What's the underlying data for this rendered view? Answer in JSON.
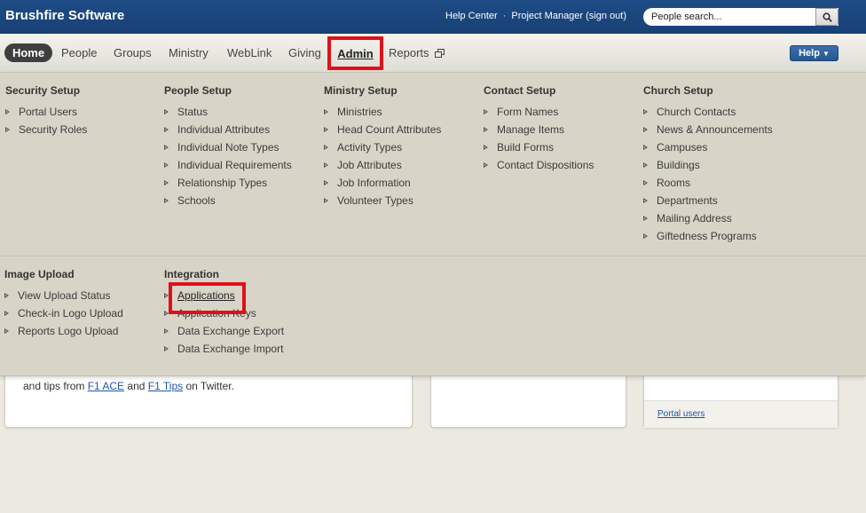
{
  "header": {
    "brand": "Brushfire Software",
    "help_center": "Help Center",
    "separator": "·",
    "user": "Project Manager (sign out)",
    "search_placeholder": "People search..."
  },
  "nav": {
    "home": "Home",
    "people": "People",
    "groups": "Groups",
    "ministry": "Ministry",
    "weblink": "WebLink",
    "giving": "Giving",
    "admin": "Admin",
    "reports": "Reports",
    "help": "Help"
  },
  "menu": {
    "security": {
      "title": "Security Setup",
      "items": [
        "Portal Users",
        "Security Roles"
      ]
    },
    "people": {
      "title": "People Setup",
      "items": [
        "Status",
        "Individual Attributes",
        "Individual Note Types",
        "Individual Requirements",
        "Relationship Types",
        "Schools"
      ]
    },
    "ministry": {
      "title": "Ministry Setup",
      "items": [
        "Ministries",
        "Head Count Attributes",
        "Activity Types",
        "Job Attributes",
        "Job Information",
        "Volunteer Types"
      ]
    },
    "contact": {
      "title": "Contact Setup",
      "items": [
        "Form Names",
        "Manage Items",
        "Build Forms",
        "Contact Dispositions"
      ]
    },
    "church": {
      "title": "Church Setup",
      "items": [
        "Church Contacts",
        "News & Announcements",
        "Campuses",
        "Buildings",
        "Rooms",
        "Departments",
        "Mailing Address",
        "Giftedness Programs"
      ]
    },
    "image": {
      "title": "Image Upload",
      "items": [
        "View Upload Status",
        "Check-in Logo Upload",
        "Reports Logo Upload"
      ]
    },
    "integration": {
      "title": "Integration",
      "items": [
        "Applications",
        "Application Keys",
        "Data Exchange Export",
        "Data Exchange Import"
      ]
    }
  },
  "content": {
    "tips_prefix": "and tips from ",
    "f1_ace": "F1 ACE",
    "and": " and ",
    "f1_tips": "F1 Tips",
    "tips_suffix": " on Twitter.",
    "portal_users": "Portal users"
  },
  "colors": {
    "header_blue": "#1f4c86",
    "highlight_red": "#e0101a",
    "panel_bg": "#d8d5c8"
  }
}
